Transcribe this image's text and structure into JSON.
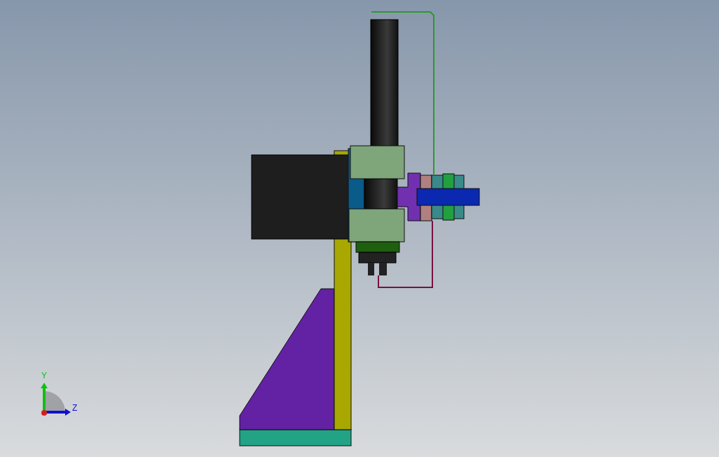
{
  "viewport": {
    "triad": {
      "axes": [
        {
          "label": "Y",
          "color": "#10c010"
        },
        {
          "label": "Z",
          "color": "#1010d0"
        }
      ]
    }
  }
}
